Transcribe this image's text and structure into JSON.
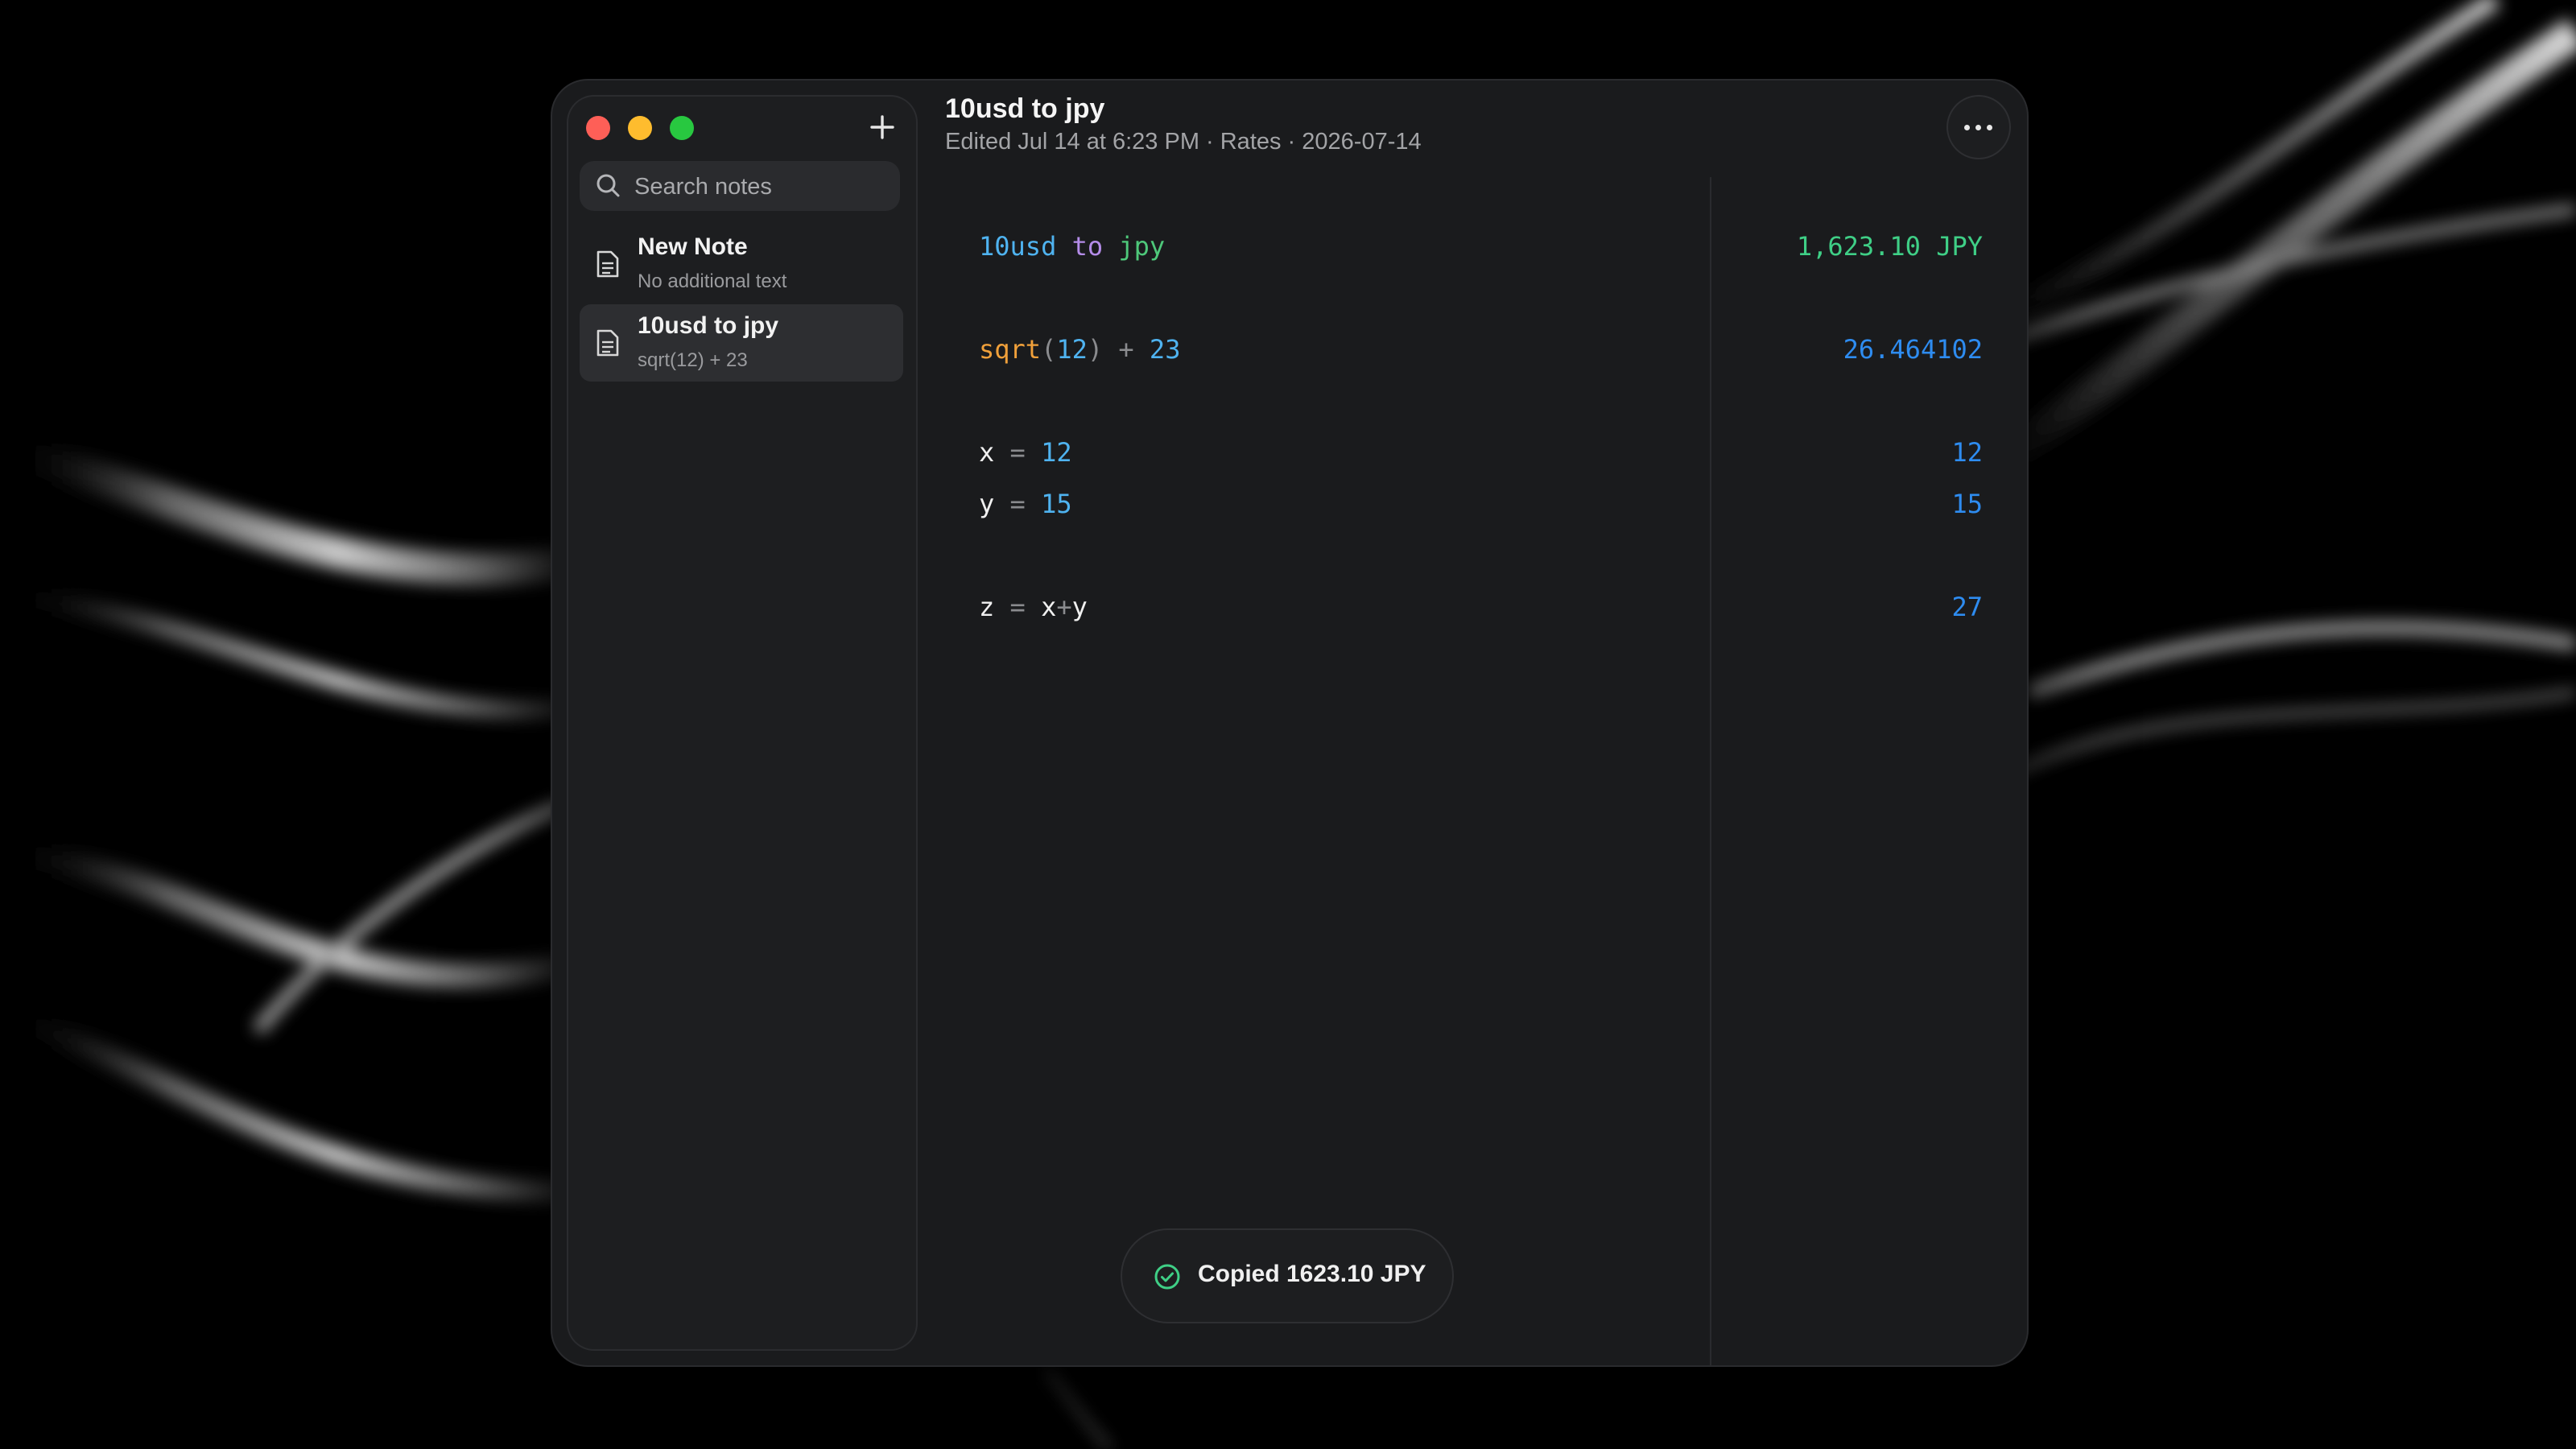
{
  "window": {
    "title": "10usd to jpy",
    "meta": "Edited Jul 14 at 6:23 PM · Rates · 2026-07-14"
  },
  "sidebar": {
    "search_placeholder": "Search notes",
    "notes": [
      {
        "title": "New Note",
        "subtitle": "No additional text",
        "selected": false
      },
      {
        "title": "10usd to jpy",
        "subtitle": "sqrt(12) + 23",
        "selected": true
      }
    ]
  },
  "editor": {
    "lines": [
      {
        "tokens": [
          [
            "10",
            "num"
          ],
          [
            "usd",
            "num"
          ],
          [
            " to ",
            "kw"
          ],
          [
            "jpy",
            "unit"
          ]
        ],
        "result": "1,623.10 JPY",
        "result_color": "green"
      },
      {
        "tokens": [
          [
            "sqrt",
            "fn"
          ],
          [
            "(",
            "paren"
          ],
          [
            "12",
            "num"
          ],
          [
            ")",
            "paren"
          ],
          [
            " + ",
            "op"
          ],
          [
            "23",
            "num"
          ]
        ],
        "result": "26.464102",
        "result_color": "blue"
      },
      {
        "tokens": [
          [
            "x",
            "var"
          ],
          [
            " = ",
            "op"
          ],
          [
            "12",
            "num"
          ]
        ],
        "result": "12",
        "result_color": "blue"
      },
      {
        "tokens": [
          [
            "y",
            "var"
          ],
          [
            " = ",
            "op"
          ],
          [
            "15",
            "num"
          ]
        ],
        "result": "15",
        "result_color": "blue"
      },
      {
        "tokens": [
          [
            "z",
            "var"
          ],
          [
            " = ",
            "op"
          ],
          [
            "x",
            "var"
          ],
          [
            "+",
            "op"
          ],
          [
            "y",
            "var"
          ]
        ],
        "result": "27",
        "result_color": "blue"
      }
    ]
  },
  "toast": {
    "text": "Copied 1623.10 JPY"
  },
  "icons": {
    "traffic_close": "red-close-icon",
    "traffic_minimize": "yellow-minimize-icon",
    "traffic_zoom": "green-zoom-icon",
    "new_note": "plus-icon",
    "search": "search-icon",
    "note": "document-icon",
    "more": "ellipsis-icon",
    "toast": "check-circle-icon"
  },
  "colors": {
    "accent_green": "#3fcf86",
    "accent_blue": "#2e8cf0",
    "keyword_purple": "#b48ce8",
    "function_orange": "#f0a03a"
  }
}
